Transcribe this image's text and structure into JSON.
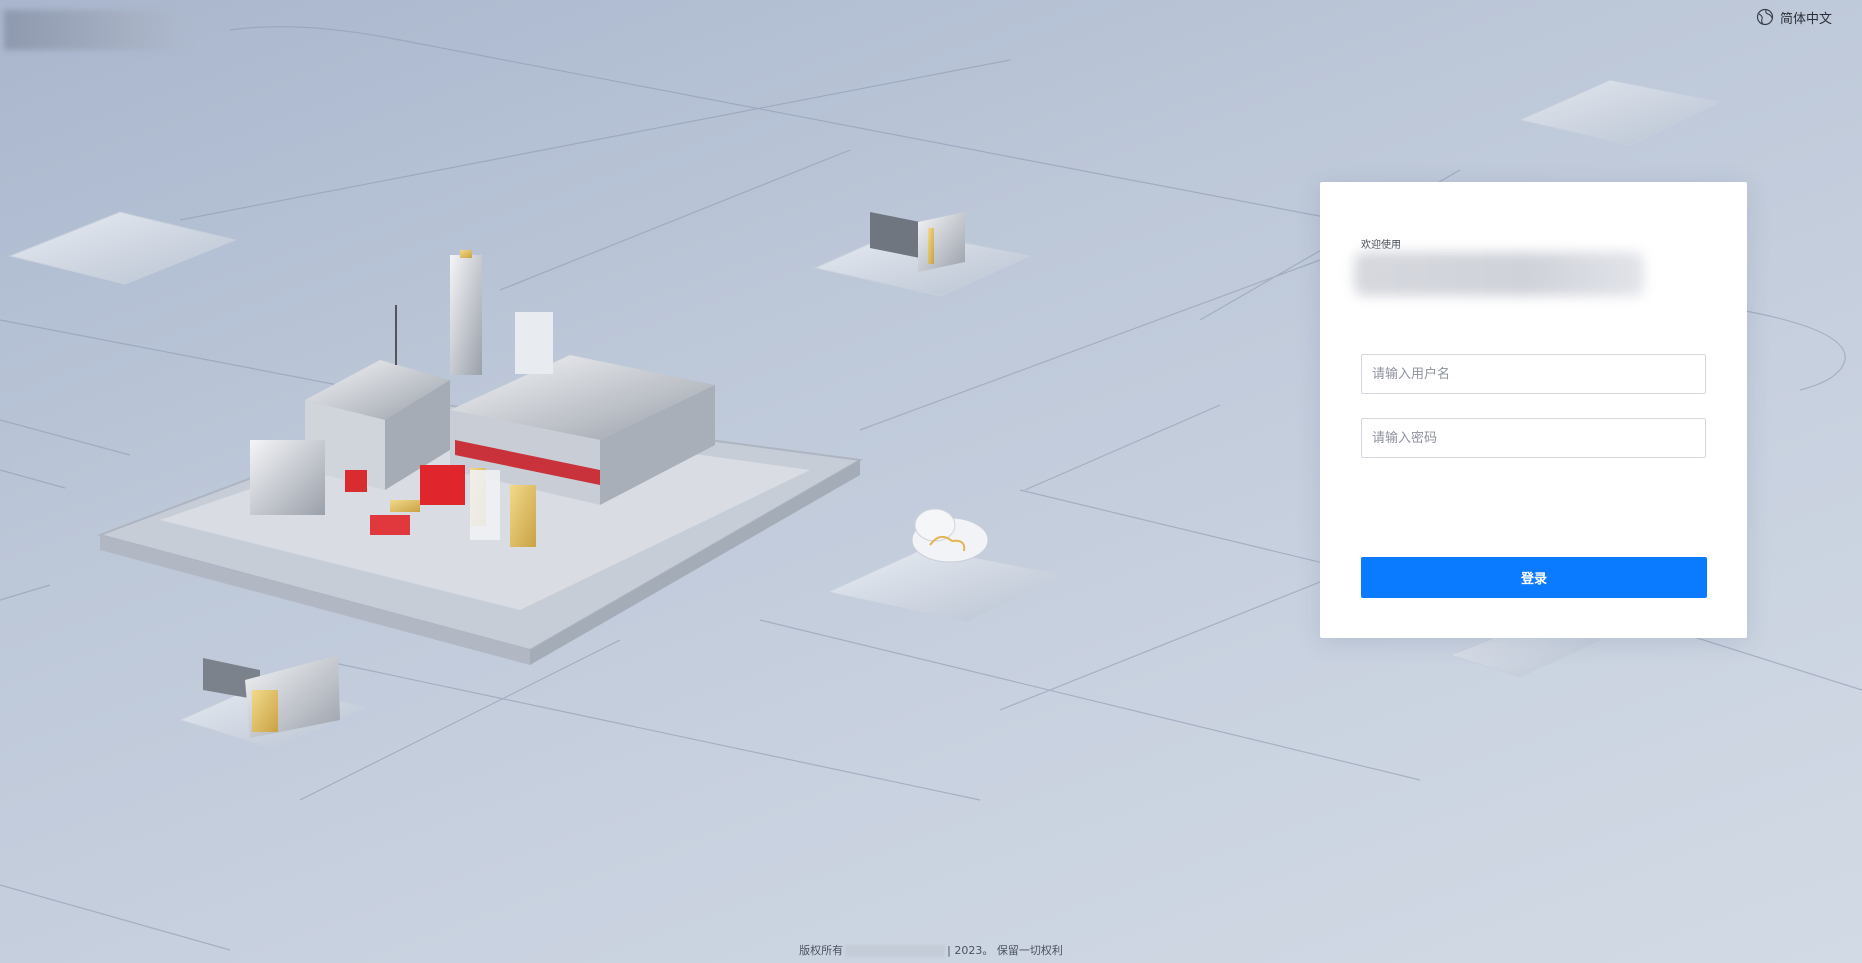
{
  "header": {
    "language_label": "简体中文",
    "language_icon": "globe-icon"
  },
  "login": {
    "welcome_text": "欢迎使用",
    "username_placeholder": "请输入用户名",
    "password_placeholder": "请输入密码",
    "submit_label": "登录"
  },
  "footer": {
    "prefix": "版权所有",
    "suffix": "| 2023。 保留一切权利"
  },
  "colors": {
    "primary_button": "#0a7bff",
    "background": "#c2ccdb"
  }
}
